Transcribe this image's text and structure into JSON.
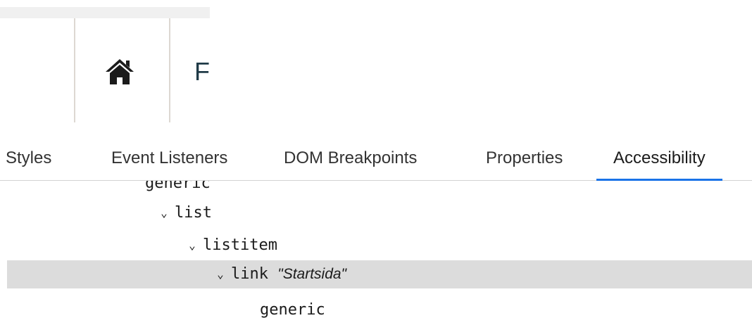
{
  "preview": {
    "heading_partial": "F",
    "home_icon": "home-icon"
  },
  "tabs": [
    {
      "label": "Styles",
      "selected": false
    },
    {
      "label": "Event Listeners",
      "selected": false
    },
    {
      "label": "DOM Breakpoints",
      "selected": false
    },
    {
      "label": "Properties",
      "selected": false
    },
    {
      "label": "Accessibility",
      "selected": true
    }
  ],
  "tree": {
    "nodes": [
      {
        "role": "generic",
        "name": "",
        "expanded": null,
        "selected": false
      },
      {
        "role": "list",
        "name": "",
        "expanded": true,
        "selected": false
      },
      {
        "role": "listitem",
        "name": "",
        "expanded": true,
        "selected": false
      },
      {
        "role": "link",
        "name": "\"Startsida\"",
        "expanded": true,
        "selected": true
      },
      {
        "role": "generic",
        "name": "",
        "expanded": null,
        "selected": false
      }
    ]
  },
  "colors": {
    "accent": "#1a73e8",
    "selection": "#dcdcdc",
    "preview_text": "#1f3a47"
  }
}
